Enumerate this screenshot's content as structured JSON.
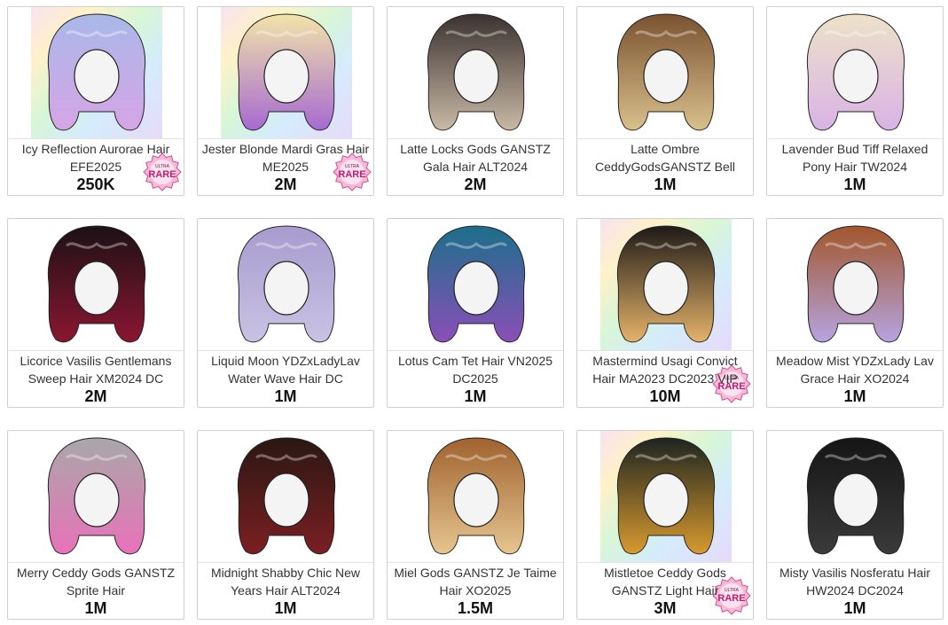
{
  "items": [
    {
      "name": "Icy Reflection Aurorae Hair EFE2025",
      "price": "250K",
      "icon": "hair-icon",
      "rare": true,
      "badge_top": "ULTRA",
      "badge_text": "RARE",
      "hair": "#a9b8e8",
      "hair2": "#d6a5e6",
      "bg": "rainbow"
    },
    {
      "name": "Jester Blonde Mardi Gras Hair ME2025",
      "price": "2M",
      "icon": "hair-icon",
      "rare": true,
      "badge_top": "ULTRA",
      "badge_text": "RARE",
      "hair": "#f2e4a8",
      "hair2": "#a66ad1",
      "bg": "rainbow"
    },
    {
      "name": "Latte Locks Gods GANSTZ Gala Hair ALT2024",
      "price": "2M",
      "icon": "hair-icon",
      "rare": false,
      "hair": "#3b3230",
      "hair2": "#c9b9a6",
      "bg": "plain"
    },
    {
      "name": "Latte Ombre CeddyGodsGANSTZ Bell",
      "price": "1M",
      "icon": "hair-icon",
      "rare": false,
      "hair": "#7a5230",
      "hair2": "#d9c08c",
      "bg": "plain"
    },
    {
      "name": "Lavender Bud Tiff Relaxed Pony Hair TW2024",
      "price": "1M",
      "icon": "hair-icon",
      "rare": false,
      "hair": "#ede2c8",
      "hair2": "#d9b3e6",
      "bg": "plain"
    },
    {
      "name": "Licorice Vasilis Gentlemans Sweep Hair XM2024 DC",
      "price": "2M",
      "icon": "hair-icon",
      "rare": false,
      "hair": "#1b1116",
      "hair2": "#8a1631",
      "bg": "plain"
    },
    {
      "name": "Liquid Moon YDZxLadyLav Water Wave Hair DC",
      "price": "1M",
      "icon": "hair-icon",
      "rare": false,
      "hair": "#a79bcf",
      "hair2": "#c9c3e3",
      "bg": "plain"
    },
    {
      "name": "Lotus Cam Tet Hair VN2025 DC2025",
      "price": "1M",
      "icon": "hair-icon",
      "rare": false,
      "hair": "#1c6f8a",
      "hair2": "#8a4fb8",
      "bg": "plain"
    },
    {
      "name": "Mastermind Usagi Convict Hair MA2023 DC2023 VIP",
      "price": "10M",
      "icon": "hair-icon",
      "rare": true,
      "badge_top": "ULTRA",
      "badge_text": "RARE",
      "hair": "#1e1a17",
      "hair2": "#e5b36a",
      "bg": "rainbow"
    },
    {
      "name": "Meadow Mist YDZxLady Lav Grace Hair XO2024",
      "price": "1M",
      "icon": "hair-icon",
      "rare": false,
      "hair": "#a2562c",
      "hair2": "#b6a4e0",
      "bg": "plain"
    },
    {
      "name": "Merry Ceddy Gods GANSTZ Sprite Hair",
      "price": "1M",
      "icon": "hair-icon",
      "rare": false,
      "hair": "#a8a8a8",
      "hair2": "#e872b9",
      "bg": "plain"
    },
    {
      "name": "Midnight Shabby Chic New Years Hair ALT2024",
      "price": "1M",
      "icon": "hair-icon",
      "rare": false,
      "hair": "#2a1713",
      "hair2": "#7b1f22",
      "bg": "plain"
    },
    {
      "name": "Miel Gods GANSTZ Je Taime Hair XO2025",
      "price": "1.5M",
      "icon": "hair-icon",
      "rare": false,
      "hair": "#a0622e",
      "hair2": "#e6c58f",
      "bg": "plain"
    },
    {
      "name": "Mistletoe Ceddy Gods GANSTZ Light Hair",
      "price": "3M",
      "icon": "hair-icon",
      "rare": true,
      "badge_top": "ULTRA",
      "badge_text": "RARE",
      "hair": "#1d2420",
      "hair2": "#d79a2f",
      "bg": "rainbow"
    },
    {
      "name": "Misty Vasilis Nosferatu Hair HW2024 DC2024",
      "price": "1M",
      "icon": "hair-icon",
      "rare": false,
      "hair": "#151515",
      "hair2": "#3a3a3a",
      "bg": "plain"
    }
  ]
}
